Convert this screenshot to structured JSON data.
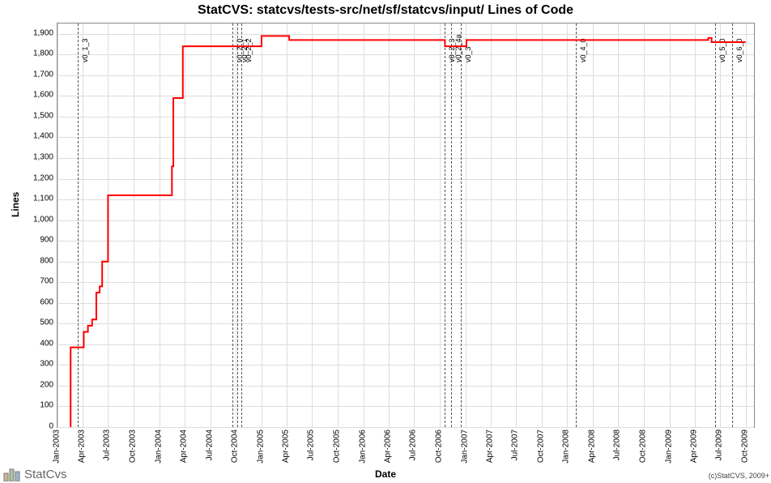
{
  "title": "StatCVS: statcvs/tests-src/net/sf/statcvs/input/ Lines of Code",
  "ylabel": "Lines",
  "xlabel": "Date",
  "footer_logo_text": "StatCvs",
  "copyright": "(c)StatCVS, 2009+",
  "chart_data": {
    "type": "line",
    "xlabel": "Date",
    "ylabel": "Lines",
    "ylim": [
      0,
      1950
    ],
    "x_ticks": [
      "Jan-2003",
      "Apr-2003",
      "Jul-2003",
      "Oct-2003",
      "Jan-2004",
      "Apr-2004",
      "Jul-2004",
      "Oct-2004",
      "Jan-2005",
      "Apr-2005",
      "Jul-2005",
      "Oct-2005",
      "Jan-2006",
      "Apr-2006",
      "Jul-2006",
      "Oct-2006",
      "Jan-2007",
      "Apr-2007",
      "Jul-2007",
      "Oct-2007",
      "Jan-2008",
      "Apr-2008",
      "Jul-2008",
      "Oct-2008",
      "Jan-2009",
      "Apr-2009",
      "Jul-2009",
      "Oct-2009"
    ],
    "y_ticks": [
      0,
      100,
      200,
      300,
      400,
      500,
      600,
      700,
      800,
      900,
      1000,
      1100,
      1200,
      1300,
      1400,
      1500,
      1600,
      1700,
      1800,
      1900
    ],
    "series": [
      {
        "name": "Lines of Code",
        "color": "#ff0000",
        "points": [
          {
            "x": "2003-02-15",
            "y": 0
          },
          {
            "x": "2003-02-17",
            "y": 385
          },
          {
            "x": "2003-04-01",
            "y": 385
          },
          {
            "x": "2003-04-05",
            "y": 460
          },
          {
            "x": "2003-04-20",
            "y": 490
          },
          {
            "x": "2003-05-05",
            "y": 520
          },
          {
            "x": "2003-05-20",
            "y": 650
          },
          {
            "x": "2003-06-01",
            "y": 680
          },
          {
            "x": "2003-06-10",
            "y": 800
          },
          {
            "x": "2003-06-25",
            "y": 800
          },
          {
            "x": "2003-07-01",
            "y": 1120
          },
          {
            "x": "2004-02-10",
            "y": 1120
          },
          {
            "x": "2004-02-15",
            "y": 1260
          },
          {
            "x": "2004-02-20",
            "y": 1590
          },
          {
            "x": "2004-03-20",
            "y": 1590
          },
          {
            "x": "2004-03-25",
            "y": 1840
          },
          {
            "x": "2004-12-15",
            "y": 1840
          },
          {
            "x": "2005-01-01",
            "y": 1890
          },
          {
            "x": "2005-04-01",
            "y": 1890
          },
          {
            "x": "2005-04-10",
            "y": 1870
          },
          {
            "x": "2006-10-15",
            "y": 1870
          },
          {
            "x": "2006-10-20",
            "y": 1840
          },
          {
            "x": "2007-01-01",
            "y": 1840
          },
          {
            "x": "2007-01-05",
            "y": 1870
          },
          {
            "x": "2009-05-15",
            "y": 1870
          },
          {
            "x": "2009-05-20",
            "y": 1880
          },
          {
            "x": "2009-06-01",
            "y": 1860
          },
          {
            "x": "2009-10-01",
            "y": 1860
          }
        ]
      }
    ],
    "markers": [
      {
        "x": "2003-03-15",
        "label": "v0_1_3"
      },
      {
        "x": "2004-09-20",
        "label": "v0_2_0"
      },
      {
        "x": "2004-10-05",
        "label": "v0_2_1"
      },
      {
        "x": "2004-10-20",
        "label": "v0_2_2"
      },
      {
        "x": "2006-10-20",
        "label": "v0_2_3"
      },
      {
        "x": "2006-11-10",
        "label": "v0_2_4a"
      },
      {
        "x": "2006-12-15",
        "label": "v0_3"
      },
      {
        "x": "2008-02-01",
        "label": "v0_4_0"
      },
      {
        "x": "2009-06-15",
        "label": "v0_5_0"
      },
      {
        "x": "2009-08-15",
        "label": "v0_6_0"
      }
    ]
  }
}
